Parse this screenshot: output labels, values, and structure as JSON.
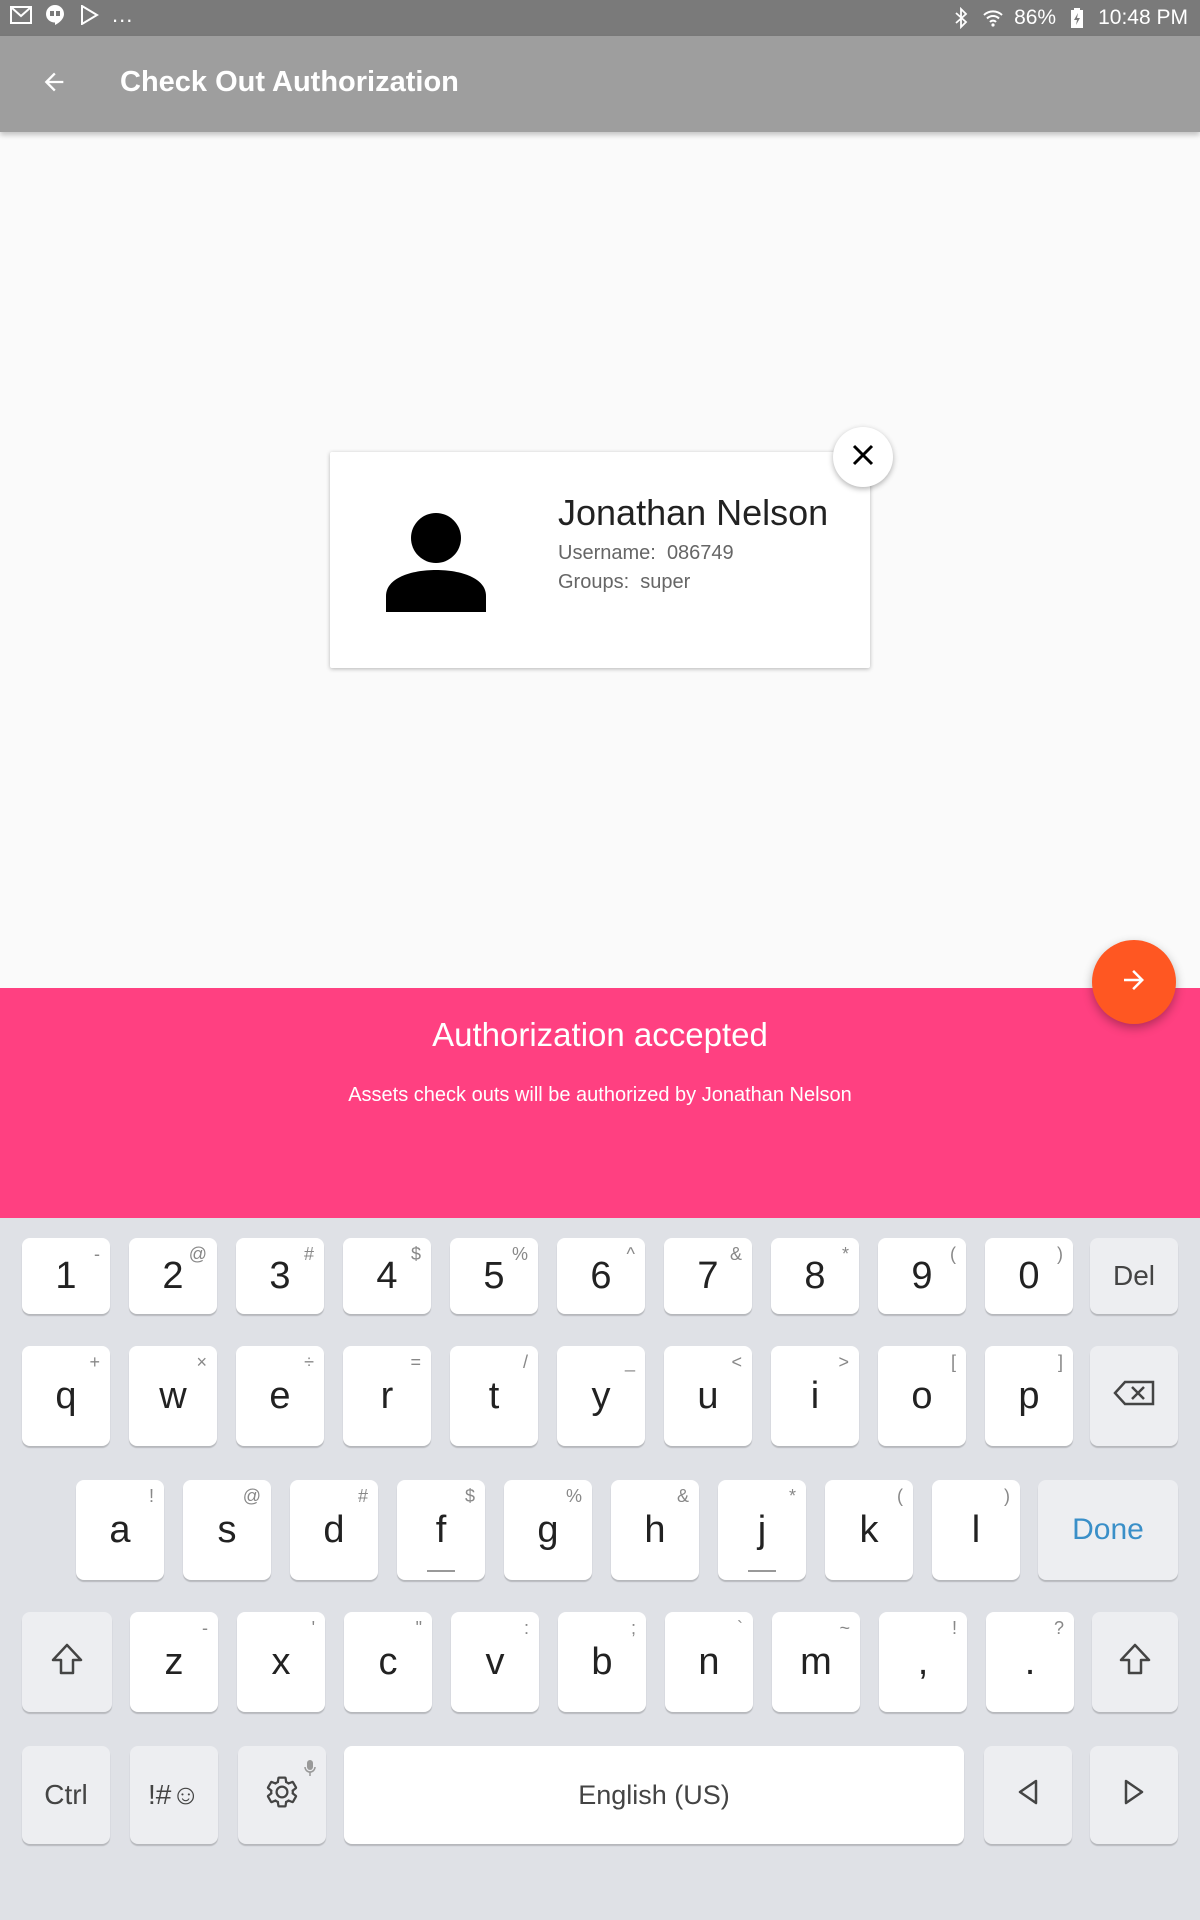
{
  "status_bar": {
    "left_icons": [
      "gmail-icon",
      "hangouts-icon",
      "play-store-icon"
    ],
    "overflow": "...",
    "battery": "86%",
    "time": "10:48 PM"
  },
  "app_bar": {
    "title": "Check Out Authorization"
  },
  "user_card": {
    "name": "Jonathan Nelson",
    "username_label": "Username:",
    "username_value": "086749",
    "groups_label": "Groups:",
    "groups_value": "super"
  },
  "banner": {
    "title": "Authorization accepted",
    "message": "Assets check outs will be authorized by Jonathan Nelson"
  },
  "keyboard": {
    "row1": [
      {
        "label": "1",
        "hint": "-"
      },
      {
        "label": "2",
        "hint": "@"
      },
      {
        "label": "3",
        "hint": "#"
      },
      {
        "label": "4",
        "hint": "$"
      },
      {
        "label": "5",
        "hint": "%"
      },
      {
        "label": "6",
        "hint": "^"
      },
      {
        "label": "7",
        "hint": "&"
      },
      {
        "label": "8",
        "hint": "*"
      },
      {
        "label": "9",
        "hint": "("
      },
      {
        "label": "0",
        "hint": ")"
      }
    ],
    "del_label": "Del",
    "row2": [
      {
        "label": "q",
        "hint": "+"
      },
      {
        "label": "w",
        "hint": "×"
      },
      {
        "label": "e",
        "hint": "÷"
      },
      {
        "label": "r",
        "hint": "="
      },
      {
        "label": "t",
        "hint": "/"
      },
      {
        "label": "y",
        "hint": "_"
      },
      {
        "label": "u",
        "hint": "<"
      },
      {
        "label": "i",
        "hint": ">"
      },
      {
        "label": "o",
        "hint": "["
      },
      {
        "label": "p",
        "hint": "]"
      }
    ],
    "row3": [
      {
        "label": "a",
        "hint": "!"
      },
      {
        "label": "s",
        "hint": "@"
      },
      {
        "label": "d",
        "hint": "#"
      },
      {
        "label": "f",
        "hint": "$"
      },
      {
        "label": "g",
        "hint": "%"
      },
      {
        "label": "h",
        "hint": "&"
      },
      {
        "label": "j",
        "hint": "*"
      },
      {
        "label": "k",
        "hint": "("
      },
      {
        "label": "l",
        "hint": ")"
      }
    ],
    "done_label": "Done",
    "row4": [
      {
        "label": "z",
        "hint": "-"
      },
      {
        "label": "x",
        "hint": "'"
      },
      {
        "label": "c",
        "hint": "\""
      },
      {
        "label": "v",
        "hint": ":"
      },
      {
        "label": "b",
        "hint": ";"
      },
      {
        "label": "n",
        "hint": "`"
      },
      {
        "label": "m",
        "hint": "~"
      },
      {
        "label": ",",
        "hint": "!"
      },
      {
        "label": ".",
        "hint": "?"
      }
    ],
    "ctrl_label": "Ctrl",
    "symbols_label": "!#☺",
    "space_label": "English (US)"
  },
  "colors": {
    "status_bar": "#7a7a7a",
    "app_bar": "#9e9e9e",
    "banner": "#ff4081",
    "fab": "#ff5722",
    "keyboard_bg": "#dfe1e6",
    "done_text": "#3a8fc8"
  }
}
